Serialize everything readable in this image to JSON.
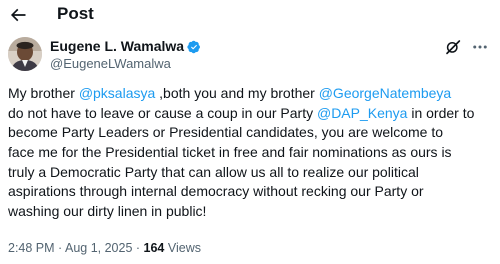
{
  "header": {
    "title": "Post"
  },
  "author": {
    "name": "Eugene L. Wamalwa",
    "handle": "@EugeneLWamalwa",
    "verified_color": "#1d9bf0"
  },
  "tweet": {
    "lines": [
      [
        {
          "t": "My brother "
        },
        {
          "t": "@pksalasya",
          "mention": true
        },
        {
          "t": " ,both you and my brother "
        },
        {
          "t": "@GeorgeNatembeya",
          "mention": true
        }
      ],
      [
        {
          "t": "do not have to leave or cause a coup in our Party "
        },
        {
          "t": "@DAP_Kenya",
          "mention": true
        },
        {
          "t": " in order to"
        }
      ],
      [
        {
          "t": "become Party Leaders or Presidential candidates, you are welcome to"
        }
      ],
      [
        {
          "t": "face me for the Presidential ticket in free and fair nominations as ours is"
        }
      ],
      [
        {
          "t": "truly a Democratic Party that can allow us all to realize our political"
        }
      ],
      [
        {
          "t": "aspirations through internal democracy without recking our Party or"
        }
      ],
      [
        {
          "t": "washing our dirty linen in public!"
        }
      ]
    ]
  },
  "meta": {
    "time": "2:48 PM",
    "separator1": " · ",
    "date": "Aug 1, 2025",
    "separator2": " · ",
    "views_count": "164",
    "views_label": " Views"
  },
  "colors": {
    "text": "#0f1419",
    "secondary": "#536471",
    "mention": "#1d9bf0"
  },
  "icons": {
    "back": "back-arrow-icon",
    "verified": "verified-badge-icon",
    "grok": "grok-icon",
    "more": "more-horizontal-icon"
  }
}
